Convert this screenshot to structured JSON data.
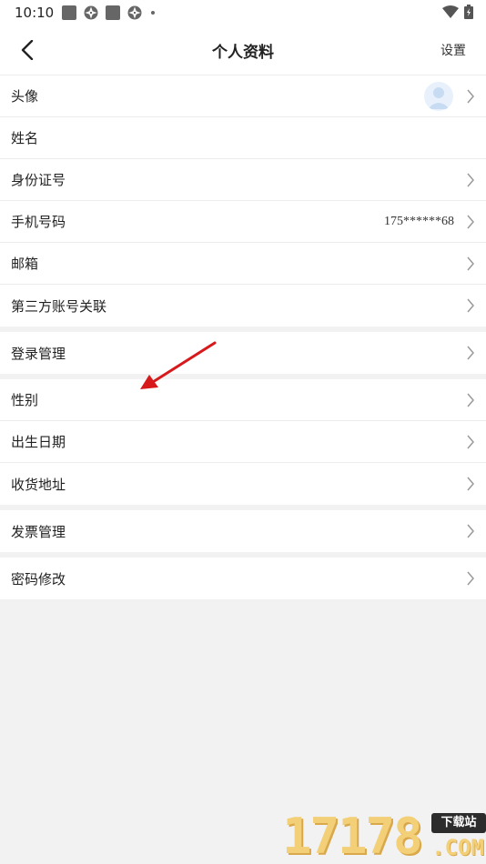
{
  "status_bar": {
    "time": "10:10"
  },
  "nav": {
    "title": "个人资料",
    "settings_label": "设置"
  },
  "groups": [
    {
      "rows": [
        {
          "label": "头像",
          "value": "",
          "has_avatar": true
        },
        {
          "label": "姓名",
          "value": ""
        },
        {
          "label": "身份证号",
          "value": ""
        },
        {
          "label": "手机号码",
          "value": "175******68"
        },
        {
          "label": "邮箱",
          "value": ""
        },
        {
          "label": "第三方账号关联",
          "value": ""
        }
      ]
    },
    {
      "rows": [
        {
          "label": "登录管理",
          "value": ""
        }
      ]
    },
    {
      "rows": [
        {
          "label": "性别",
          "value": ""
        },
        {
          "label": "出生日期",
          "value": ""
        },
        {
          "label": "收货地址",
          "value": ""
        }
      ]
    },
    {
      "rows": [
        {
          "label": "发票管理",
          "value": ""
        }
      ]
    },
    {
      "rows": [
        {
          "label": "密码修改",
          "value": ""
        }
      ]
    }
  ],
  "watermark": {
    "number": "17178",
    "badge": "下载站",
    "domain": ".COM"
  },
  "colors": {
    "background": "#f2f2f2",
    "surface": "#ffffff",
    "divider": "#ececec",
    "chevron": "#9a9a9a",
    "annotation_arrow": "#d8191c"
  }
}
